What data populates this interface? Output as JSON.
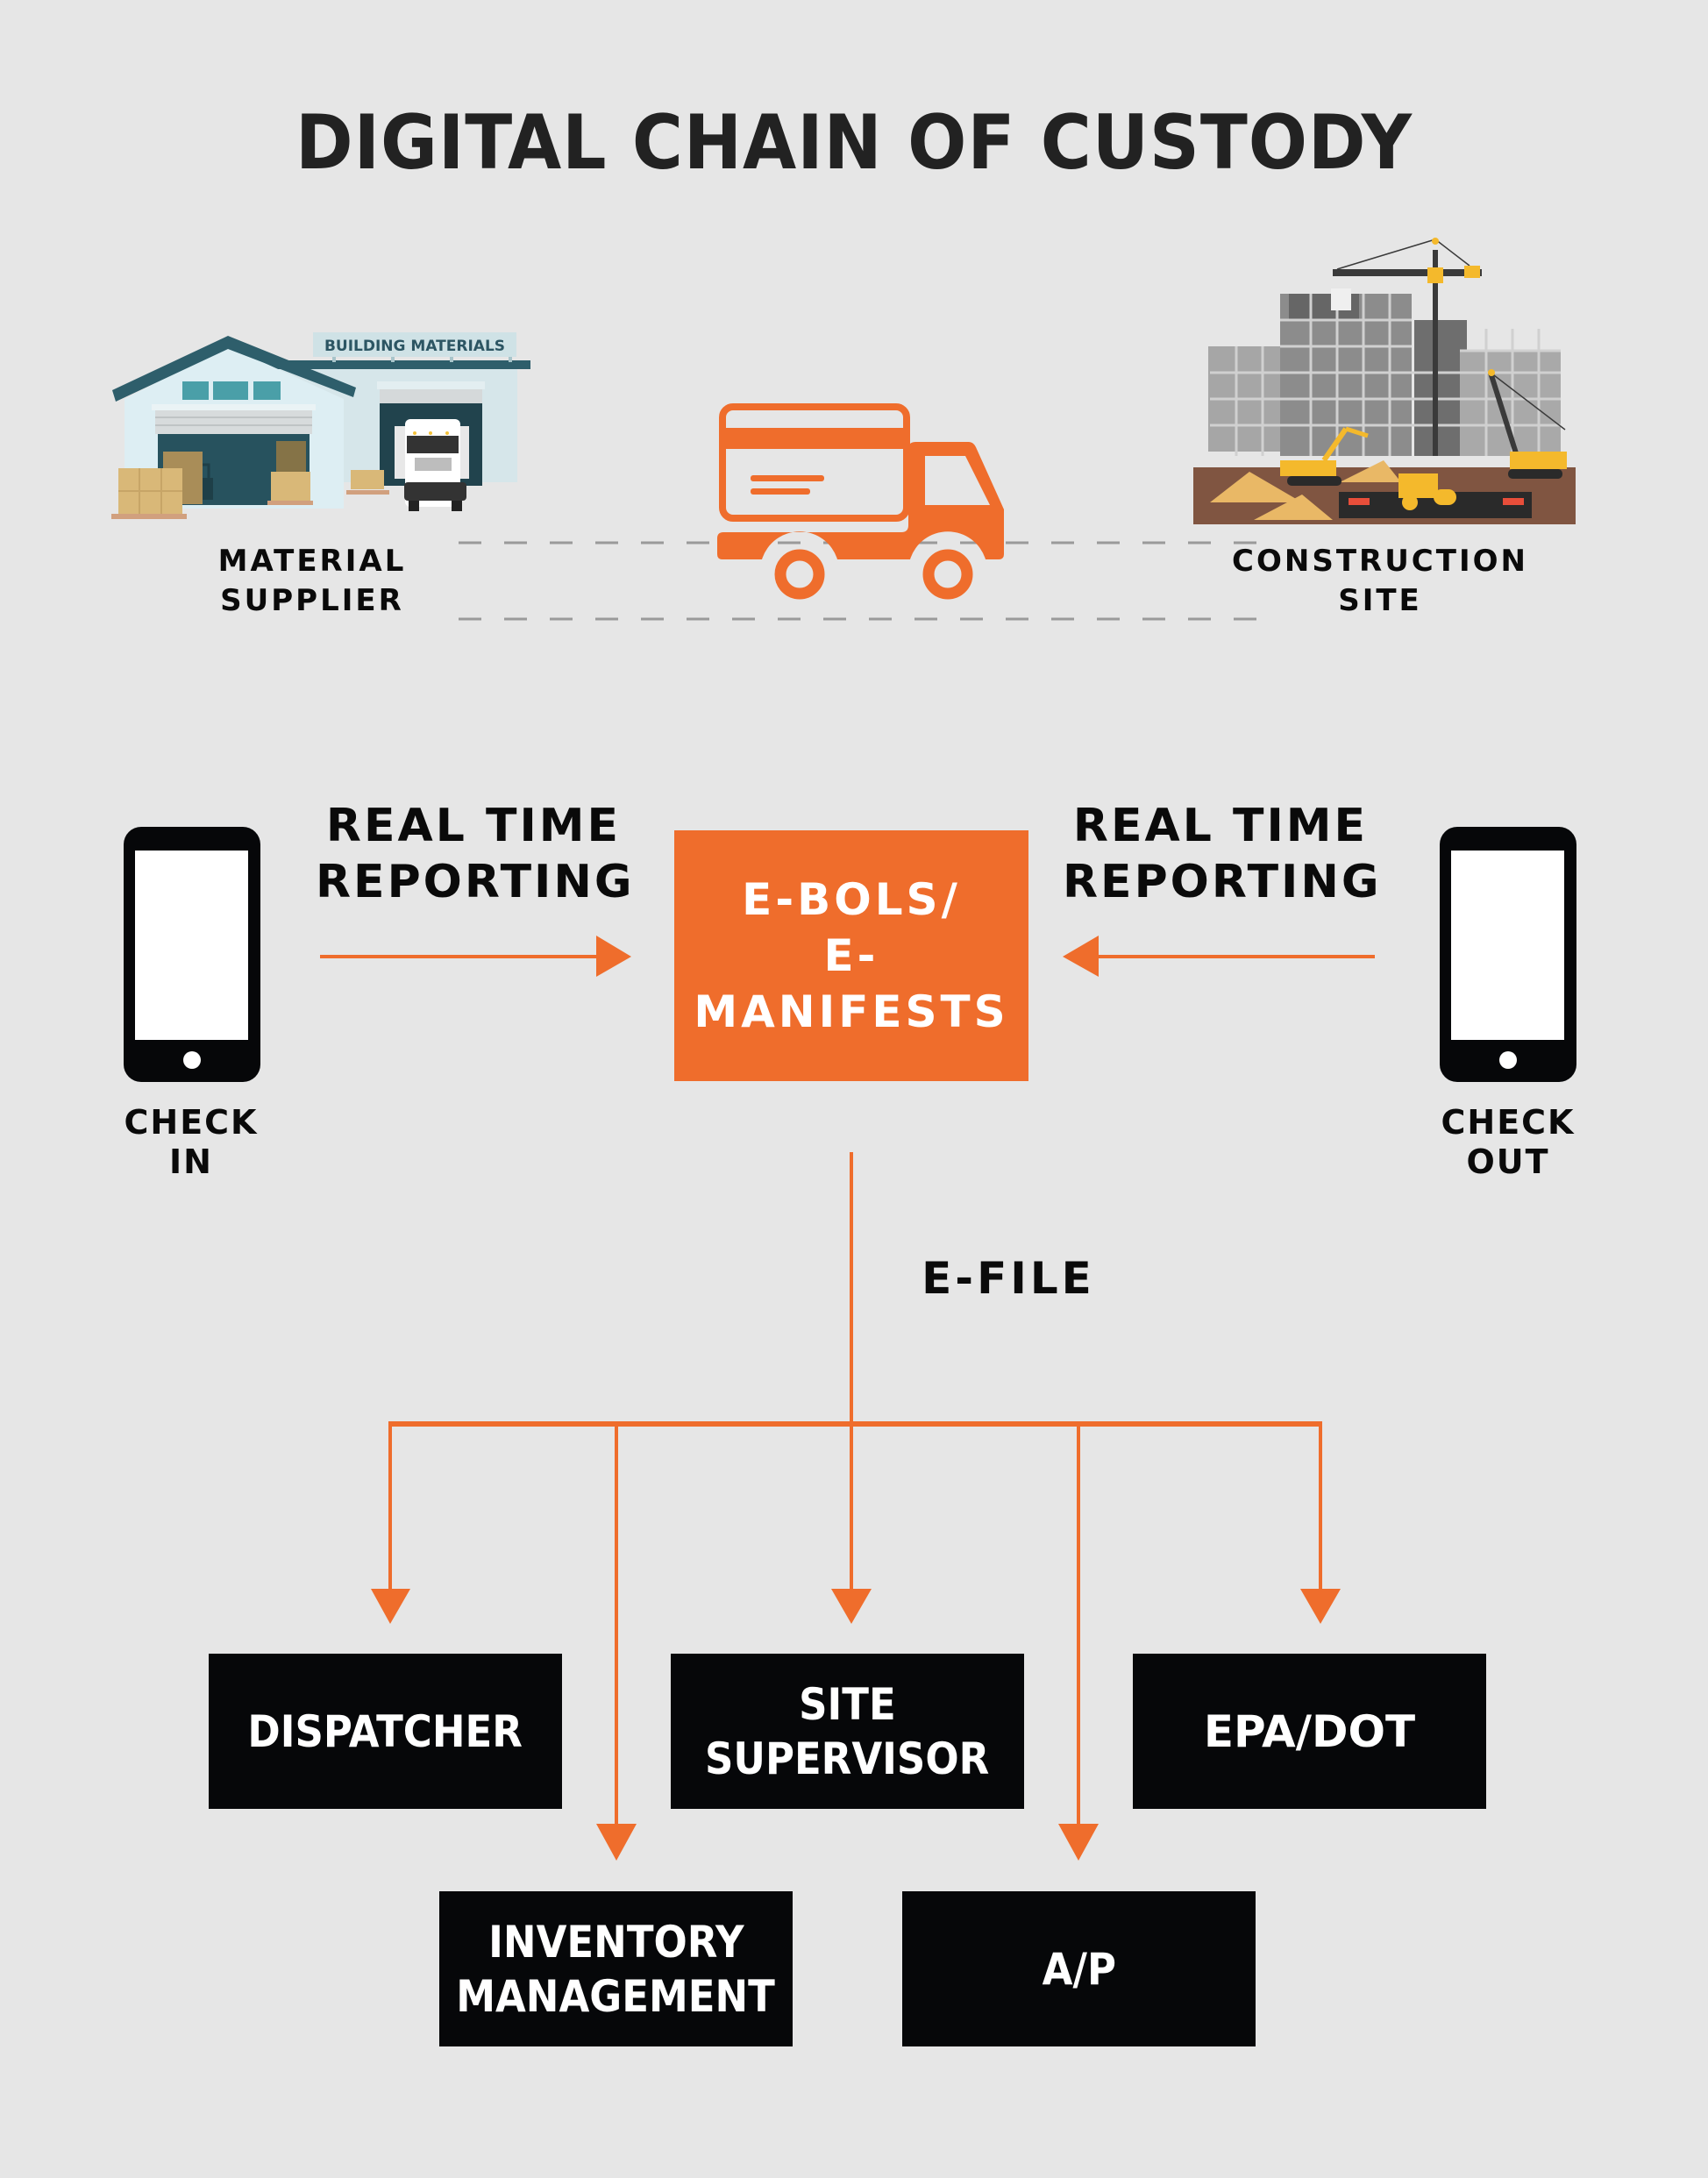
{
  "title": "DIGITAL CHAIN OF CUSTODY",
  "colors": {
    "background": "#E6E6E6",
    "accent": "#EF6D2C",
    "box_dark": "#060709",
    "text": "#0A0A0A",
    "title": "#222222",
    "dash": "#9A9A9A"
  },
  "top_flow": {
    "source": {
      "illustration": "warehouse-illustration",
      "sign": "BUILDING MATERIALS",
      "label_lines": [
        "MATERIAL",
        "SUPPLIER"
      ]
    },
    "vehicle": {
      "icon": "delivery-truck-icon"
    },
    "destination": {
      "illustration": "construction-site-illustration",
      "label_lines": [
        "CONSTRUCTION",
        "SITE"
      ]
    }
  },
  "reporting": {
    "left": {
      "device_icon": "smartphone-icon",
      "label_lines": [
        "CHECK",
        "IN"
      ],
      "arrow_label_lines": [
        "REAL TIME",
        "REPORTING"
      ],
      "arrow_direction": "right"
    },
    "center": {
      "label_lines": [
        "E-BOLS/",
        "E-MANIFESTS"
      ]
    },
    "right": {
      "device_icon": "smartphone-icon",
      "label_lines": [
        "CHECK",
        "OUT"
      ],
      "arrow_label_lines": [
        "REAL TIME",
        "REPORTING"
      ],
      "arrow_direction": "left"
    }
  },
  "distribution": {
    "connector_label": "E-FILE",
    "recipients": [
      {
        "label_lines": [
          "DISPATCHER"
        ],
        "row": 1
      },
      {
        "label_lines": [
          "INVENTORY",
          "MANAGEMENT"
        ],
        "row": 2
      },
      {
        "label_lines": [
          "SITE",
          "SUPERVISOR"
        ],
        "row": 1
      },
      {
        "label_lines": [
          "A/P"
        ],
        "row": 2
      },
      {
        "label_lines": [
          "EPA/DOT"
        ],
        "row": 1
      }
    ]
  }
}
